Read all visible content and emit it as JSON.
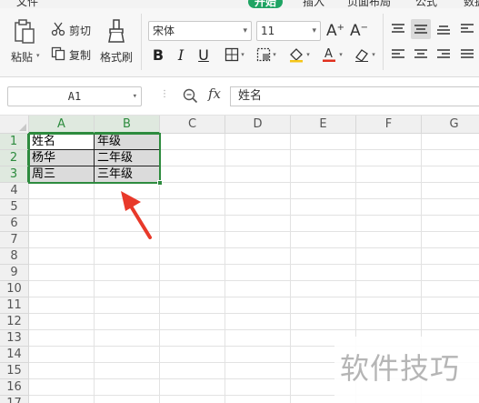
{
  "menu": [
    {
      "label": "文件",
      "active": false
    },
    {
      "label": "开始",
      "active": true
    },
    {
      "label": "插入",
      "active": false
    },
    {
      "label": "页面布局",
      "active": false
    },
    {
      "label": "公式",
      "active": false
    },
    {
      "label": "数据",
      "active": false
    }
  ],
  "ribbon": {
    "paste_label": "粘贴",
    "cut_label": "剪切",
    "copy_label": "复制",
    "format_painter_label": "格式刷",
    "font_name": "宋体",
    "font_size": "11",
    "bold": "B",
    "italic": "I",
    "underline": "U",
    "font_color": "#e0301e",
    "accent_green": "#1fa463"
  },
  "formula_bar": {
    "name_box": "A1",
    "fx": "fx",
    "content": "姓名"
  },
  "grid": {
    "columns": [
      "A",
      "B",
      "C",
      "D",
      "E",
      "F",
      "G"
    ],
    "selected_columns": [
      "A",
      "B"
    ],
    "rows": [
      "1",
      "2",
      "3",
      "4",
      "5",
      "6",
      "7",
      "8",
      "9",
      "10",
      "11",
      "12",
      "13",
      "14",
      "15",
      "16",
      "17"
    ],
    "selected_rows": [
      "1",
      "2",
      "3"
    ],
    "cells": [
      {
        "ref": "A1",
        "value": "姓名"
      },
      {
        "ref": "B1",
        "value": "年级"
      },
      {
        "ref": "A2",
        "value": "杨华"
      },
      {
        "ref": "B2",
        "value": "二年级"
      },
      {
        "ref": "A3",
        "value": "周三"
      },
      {
        "ref": "B3",
        "value": "三年级"
      }
    ],
    "selection": "A1:B3",
    "selection_color": "#2d8b3e"
  },
  "annotation": {
    "arrow_color": "#e8392a"
  },
  "watermark": "软件技巧"
}
